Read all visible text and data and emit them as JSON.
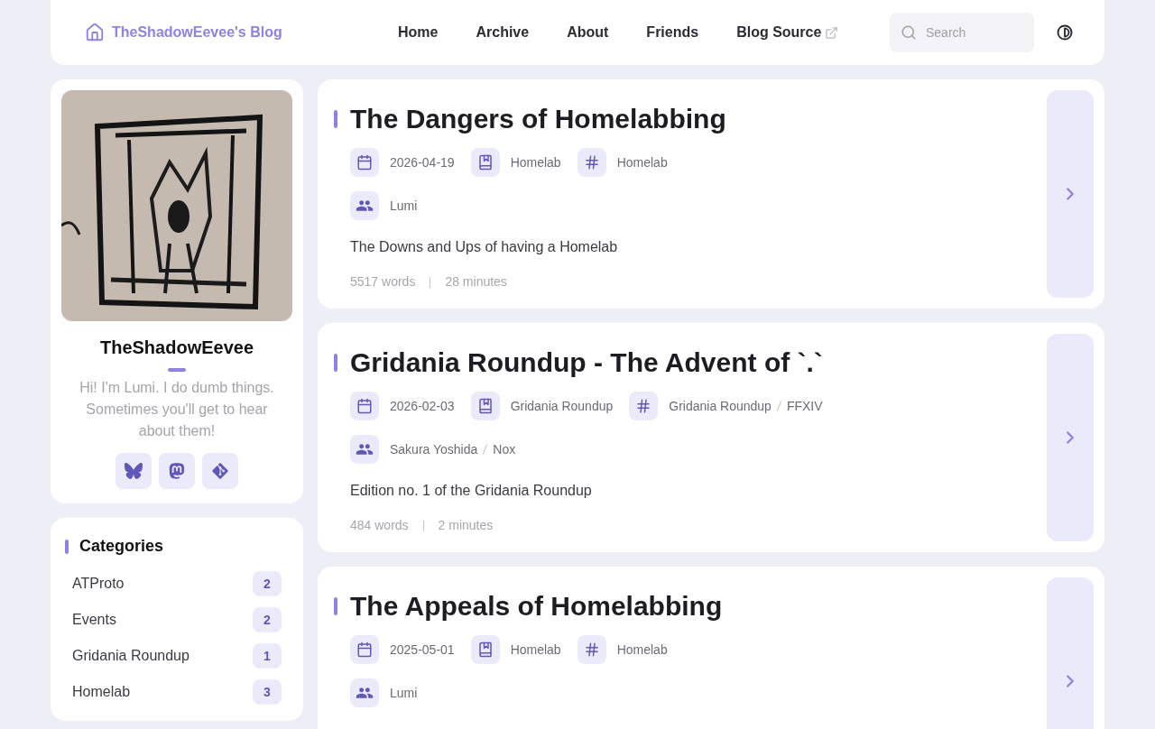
{
  "header": {
    "site_title": "TheShadowEevee's Blog",
    "nav": [
      {
        "label": "Home",
        "external": false
      },
      {
        "label": "Archive",
        "external": false
      },
      {
        "label": "About",
        "external": false
      },
      {
        "label": "Friends",
        "external": false
      },
      {
        "label": "Blog Source",
        "external": true
      }
    ],
    "search": {
      "placeholder": "Search"
    }
  },
  "profile": {
    "name": "TheShadowEevee",
    "bio": "Hi! I'm Lumi. I do dumb things. Sometimes you'll get to hear about them!",
    "links": [
      {
        "kind": "bluesky"
      },
      {
        "kind": "mastodon"
      },
      {
        "kind": "git"
      }
    ]
  },
  "categories": {
    "title": "Categories",
    "items": [
      {
        "name": "ATProto",
        "count": "2"
      },
      {
        "name": "Events",
        "count": "2"
      },
      {
        "name": "Gridania Roundup",
        "count": "1"
      },
      {
        "name": "Homelab",
        "count": "3"
      }
    ]
  },
  "posts": [
    {
      "title": "The Dangers of Homelabbing",
      "date": "2026-04-19",
      "category": "Homelab",
      "tags": [
        "Homelab"
      ],
      "authors": [
        "Lumi"
      ],
      "description": "The Downs and Ups of having a Homelab",
      "words": "5517 words",
      "minutes": "28 minutes"
    },
    {
      "title": "Gridania Roundup - The Advent of `.`",
      "date": "2026-02-03",
      "category": "Gridania Roundup",
      "tags": [
        "Gridania Roundup",
        "FFXIV"
      ],
      "authors": [
        "Sakura Yoshida",
        "Nox"
      ],
      "description": "Edition no. 1 of the Gridania Roundup",
      "words": "484 words",
      "minutes": "2 minutes"
    },
    {
      "title": "The Appeals of Homelabbing",
      "date": "2025-05-01",
      "category": "Homelab",
      "tags": [
        "Homelab"
      ],
      "authors": [
        "Lumi"
      ]
    }
  ]
}
